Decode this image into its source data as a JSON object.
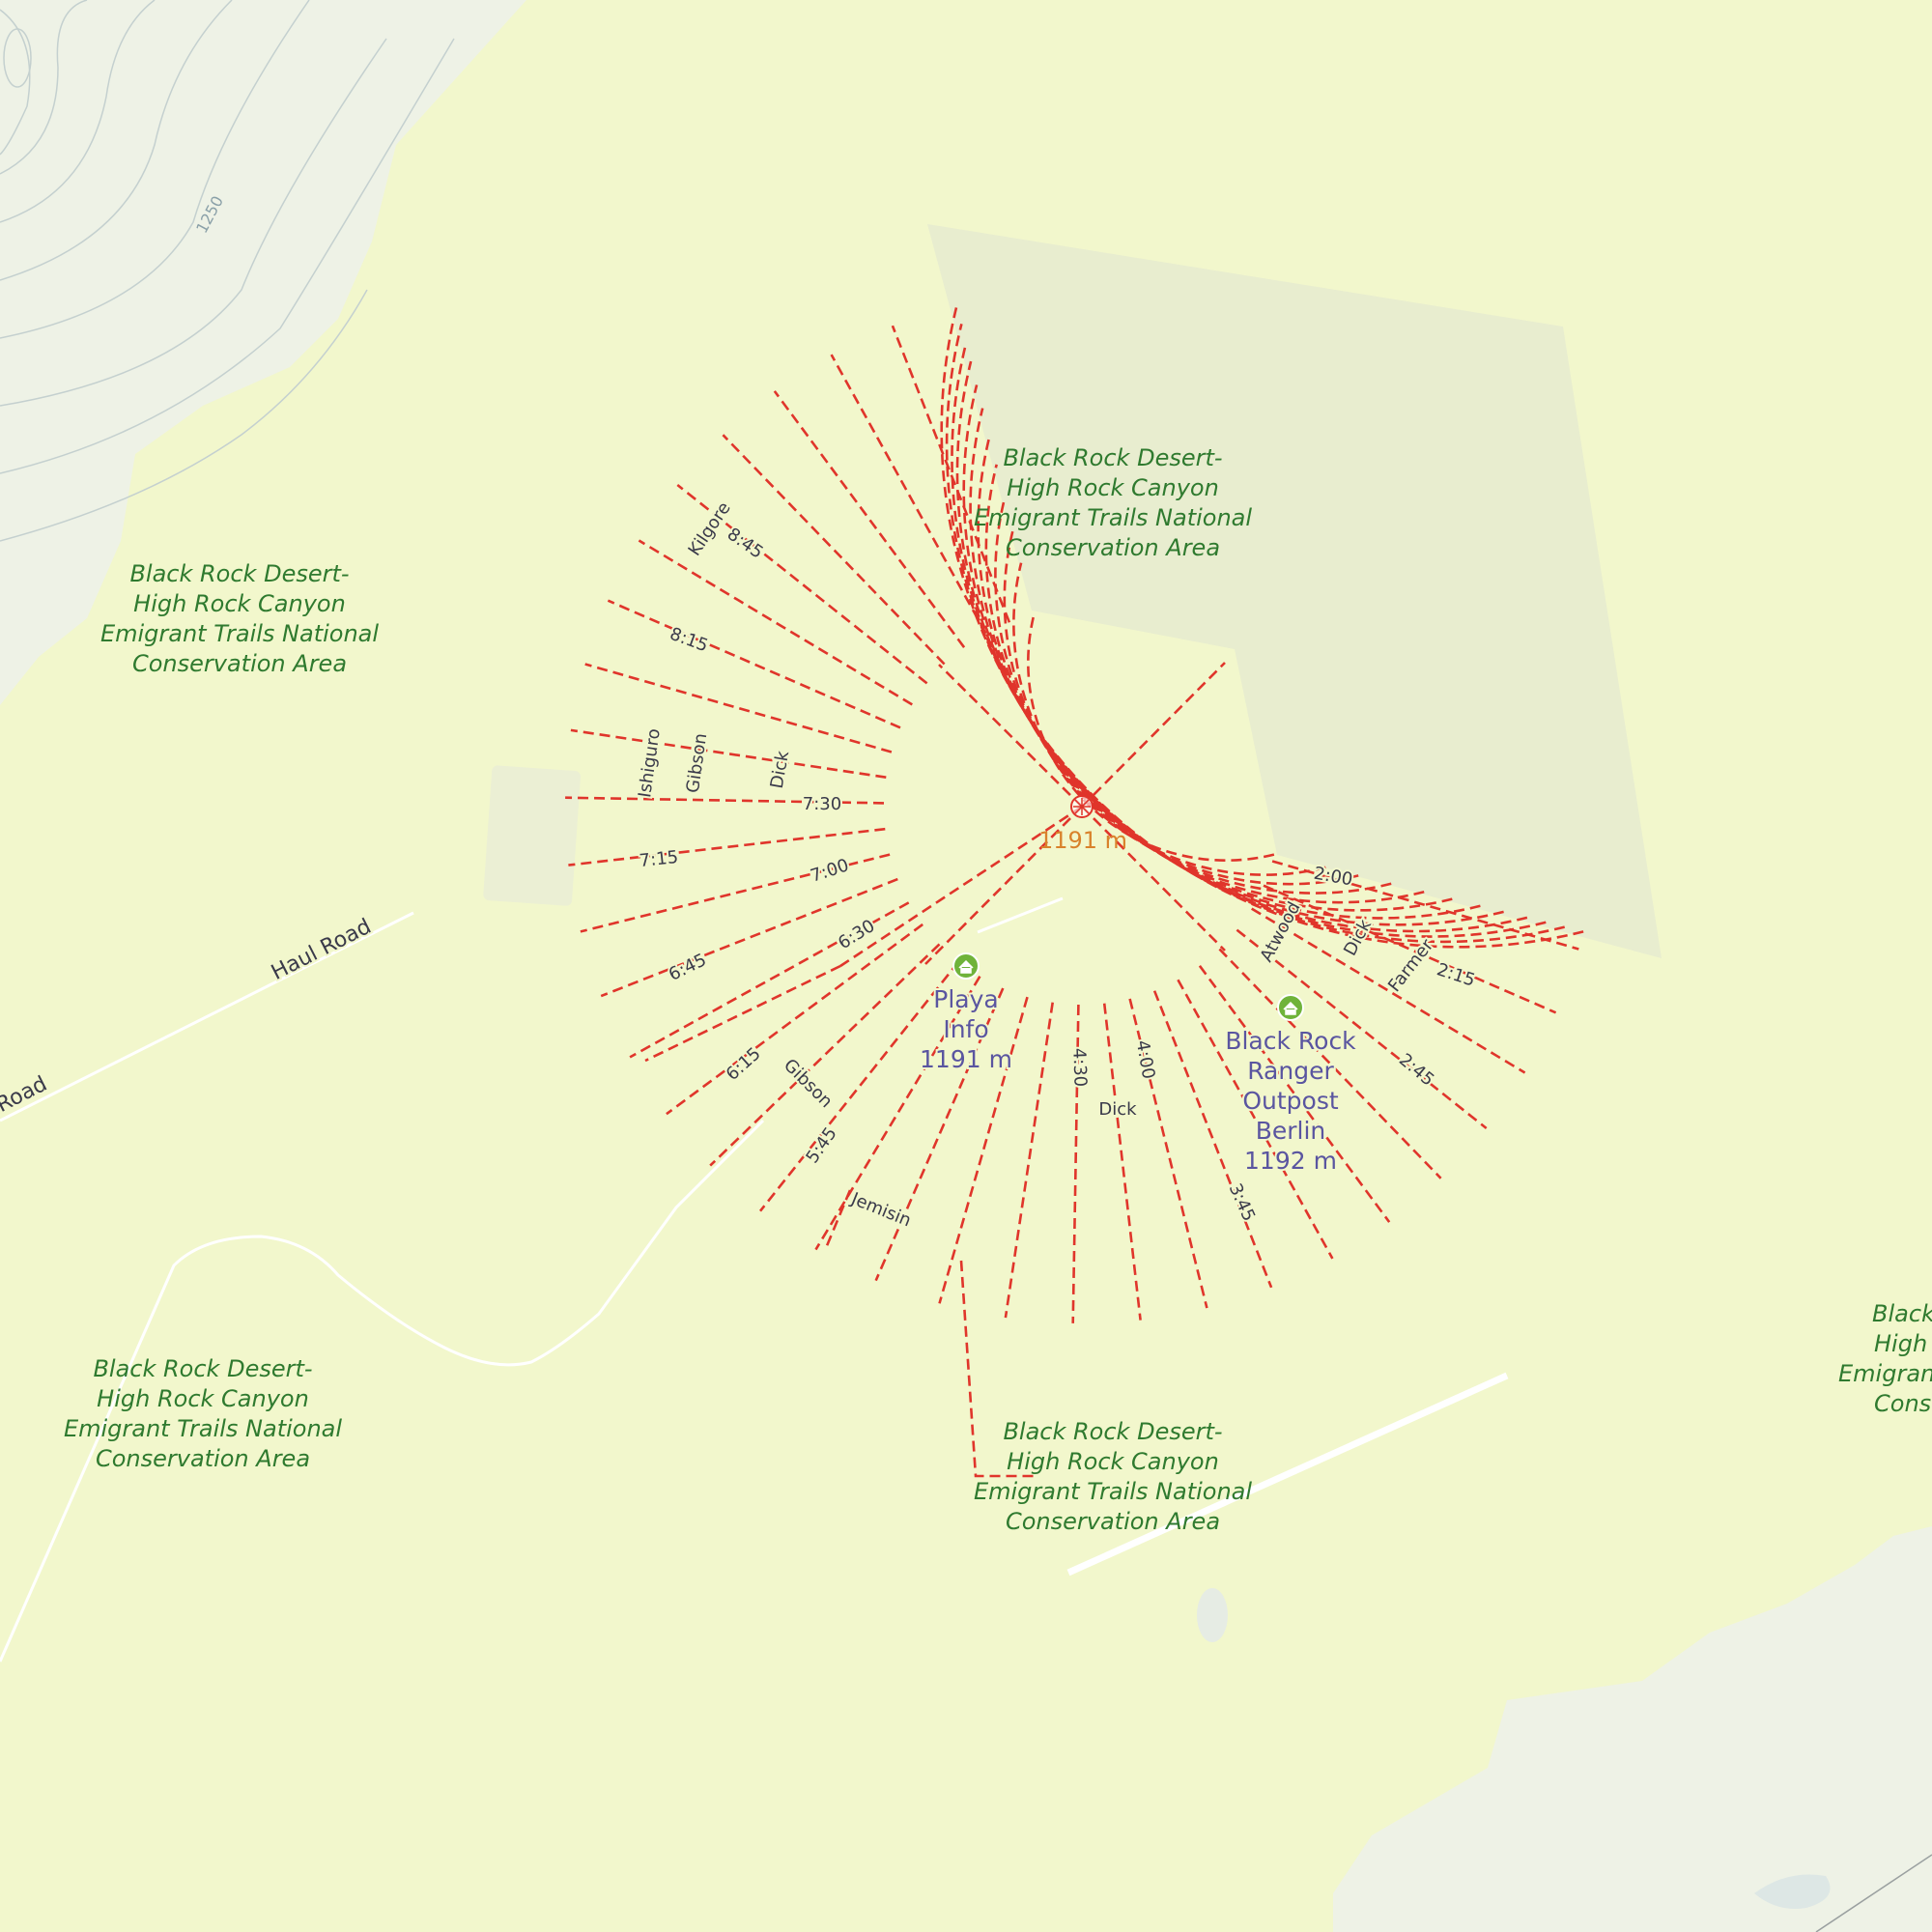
{
  "map": {
    "area_labels": [
      {
        "id": "nca-north",
        "lines": [
          "Black Rock Desert-",
          "High Rock Canyon",
          "Emigrant Trails National",
          "Conservation Area"
        ]
      },
      {
        "id": "nca-west",
        "lines": [
          "Black Rock Desert-",
          "High Rock Canyon",
          "Emigrant Trails National",
          "Conservation Area"
        ]
      },
      {
        "id": "nca-southwest",
        "lines": [
          "Black Rock Desert-",
          "High Rock Canyon",
          "Emigrant Trails National",
          "Conservation Area"
        ]
      },
      {
        "id": "nca-south",
        "lines": [
          "Black Rock Desert-",
          "High Rock Canyon",
          "Emigrant Trails National",
          "Conservation Area"
        ]
      },
      {
        "id": "nca-east",
        "lines": [
          "Black",
          "High",
          "Emigrant",
          "Conse"
        ]
      }
    ],
    "roads": {
      "haul_road": "Haul Road",
      "road_fragment": "Road"
    },
    "contour_label": "1250",
    "center": {
      "elevation": "1191 m",
      "icon": "compass-rose-icon"
    },
    "pois": [
      {
        "id": "playa-info",
        "lines": [
          "Playa",
          "Info",
          "1191 m"
        ],
        "icon": "home-icon",
        "color": "#6fb33a"
      },
      {
        "id": "ranger-outpost",
        "lines": [
          "Black Rock",
          "Ranger",
          "Outpost",
          "Berlin",
          "1192 m"
        ],
        "icon": "home-icon",
        "color": "#6fb33a"
      }
    ],
    "street_labels": {
      "kilgore": "Kilgore",
      "t845": "8:45",
      "t815": "8:15",
      "ishiguro": "Ishiguro",
      "gibson_w": "Gibson",
      "dick_w": "Dick",
      "t730": "7:30",
      "t715": "7:15",
      "t700": "7:00",
      "t645": "6:45",
      "t630": "6:30",
      "t615": "6:15",
      "gibson_s": "Gibson",
      "t545": "5:45",
      "jemisin": "Jemisin",
      "t430": "4:30",
      "t400": "4:00",
      "dick_s": "Dick",
      "t345": "3:45",
      "t245": "2:45",
      "t215": "2:15",
      "farmer": "Farmer",
      "dick_e": "Dick",
      "atwood": "Atwood",
      "t200": "2:00"
    },
    "colors": {
      "background": "#f2f7cc",
      "mountain": "#eef2e6",
      "closure": "#e8edcf",
      "street": "#e0352b",
      "area_label": "#2f7a2f",
      "poi_label": "#5a55a0",
      "peak_label": "#d9822b"
    }
  }
}
